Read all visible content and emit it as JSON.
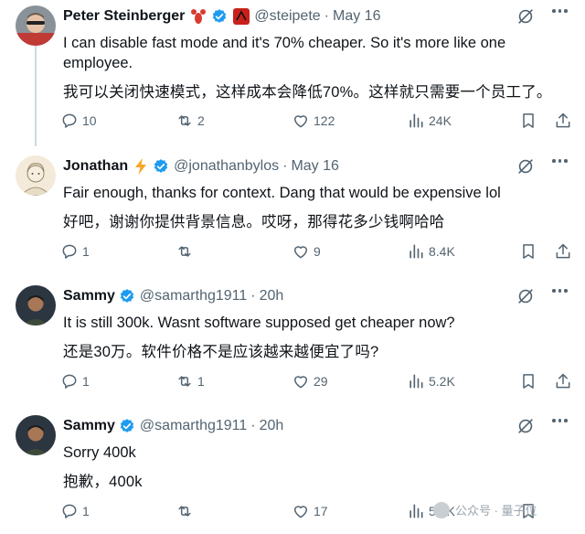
{
  "tweets": [
    {
      "name": "Peter Steinberger",
      "emoji": "lobster",
      "handle": "@steipete",
      "date": "May 16",
      "text": "I can disable fast mode and it's 70% cheaper. So it's more like one employee.",
      "translation": "我可以关闭快速模式，这样成本会降低70%。这样就只需要一个员工了。",
      "replies": "10",
      "reposts": "2",
      "likes": "122",
      "views": "24K"
    },
    {
      "name": "Jonathan",
      "emoji": "lightning",
      "handle": "@jonathanbylos",
      "date": "May 16",
      "text": "Fair enough, thanks for context. Dang that would be expensive lol",
      "translation": "好吧，谢谢你提供背景信息。哎呀，那得花多少钱啊哈哈",
      "replies": "1",
      "reposts": "",
      "likes": "9",
      "views": "8.4K"
    },
    {
      "name": "Sammy",
      "emoji": "",
      "handle": "@samarthg1911",
      "date": "20h",
      "text": "It is still 300k. Wasnt software supposed get cheaper now?",
      "translation": "还是30万。软件价格不是应该越来越便宜了吗?",
      "replies": "1",
      "reposts": "1",
      "likes": "29",
      "views": "5.2K"
    },
    {
      "name": "Sammy",
      "emoji": "",
      "handle": "@samarthg1911",
      "date": "20h",
      "text": "Sorry 400k",
      "translation": "抱歉，400k",
      "replies": "1",
      "reposts": "",
      "likes": "17",
      "views": "5.1K"
    }
  ],
  "separator": "·",
  "watermark": "公众号 · 量子位",
  "colors": {
    "text": "#0f1419",
    "muted": "#536471",
    "verified": "#1d9bf0",
    "thread_line": "#cfd9de"
  }
}
